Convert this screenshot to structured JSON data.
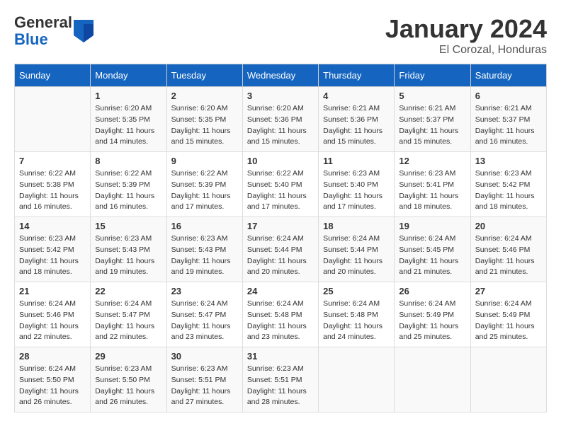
{
  "logo": {
    "general": "General",
    "blue": "Blue"
  },
  "title": "January 2024",
  "location": "El Corozal, Honduras",
  "days_of_week": [
    "Sunday",
    "Monday",
    "Tuesday",
    "Wednesday",
    "Thursday",
    "Friday",
    "Saturday"
  ],
  "weeks": [
    [
      {
        "day": "",
        "sunrise": "",
        "sunset": "",
        "daylight": ""
      },
      {
        "day": "1",
        "sunrise": "Sunrise: 6:20 AM",
        "sunset": "Sunset: 5:35 PM",
        "daylight": "Daylight: 11 hours and 14 minutes."
      },
      {
        "day": "2",
        "sunrise": "Sunrise: 6:20 AM",
        "sunset": "Sunset: 5:35 PM",
        "daylight": "Daylight: 11 hours and 15 minutes."
      },
      {
        "day": "3",
        "sunrise": "Sunrise: 6:20 AM",
        "sunset": "Sunset: 5:36 PM",
        "daylight": "Daylight: 11 hours and 15 minutes."
      },
      {
        "day": "4",
        "sunrise": "Sunrise: 6:21 AM",
        "sunset": "Sunset: 5:36 PM",
        "daylight": "Daylight: 11 hours and 15 minutes."
      },
      {
        "day": "5",
        "sunrise": "Sunrise: 6:21 AM",
        "sunset": "Sunset: 5:37 PM",
        "daylight": "Daylight: 11 hours and 15 minutes."
      },
      {
        "day": "6",
        "sunrise": "Sunrise: 6:21 AM",
        "sunset": "Sunset: 5:37 PM",
        "daylight": "Daylight: 11 hours and 16 minutes."
      }
    ],
    [
      {
        "day": "7",
        "sunrise": "Sunrise: 6:22 AM",
        "sunset": "Sunset: 5:38 PM",
        "daylight": "Daylight: 11 hours and 16 minutes."
      },
      {
        "day": "8",
        "sunrise": "Sunrise: 6:22 AM",
        "sunset": "Sunset: 5:39 PM",
        "daylight": "Daylight: 11 hours and 16 minutes."
      },
      {
        "day": "9",
        "sunrise": "Sunrise: 6:22 AM",
        "sunset": "Sunset: 5:39 PM",
        "daylight": "Daylight: 11 hours and 17 minutes."
      },
      {
        "day": "10",
        "sunrise": "Sunrise: 6:22 AM",
        "sunset": "Sunset: 5:40 PM",
        "daylight": "Daylight: 11 hours and 17 minutes."
      },
      {
        "day": "11",
        "sunrise": "Sunrise: 6:23 AM",
        "sunset": "Sunset: 5:40 PM",
        "daylight": "Daylight: 11 hours and 17 minutes."
      },
      {
        "day": "12",
        "sunrise": "Sunrise: 6:23 AM",
        "sunset": "Sunset: 5:41 PM",
        "daylight": "Daylight: 11 hours and 18 minutes."
      },
      {
        "day": "13",
        "sunrise": "Sunrise: 6:23 AM",
        "sunset": "Sunset: 5:42 PM",
        "daylight": "Daylight: 11 hours and 18 minutes."
      }
    ],
    [
      {
        "day": "14",
        "sunrise": "Sunrise: 6:23 AM",
        "sunset": "Sunset: 5:42 PM",
        "daylight": "Daylight: 11 hours and 18 minutes."
      },
      {
        "day": "15",
        "sunrise": "Sunrise: 6:23 AM",
        "sunset": "Sunset: 5:43 PM",
        "daylight": "Daylight: 11 hours and 19 minutes."
      },
      {
        "day": "16",
        "sunrise": "Sunrise: 6:23 AM",
        "sunset": "Sunset: 5:43 PM",
        "daylight": "Daylight: 11 hours and 19 minutes."
      },
      {
        "day": "17",
        "sunrise": "Sunrise: 6:24 AM",
        "sunset": "Sunset: 5:44 PM",
        "daylight": "Daylight: 11 hours and 20 minutes."
      },
      {
        "day": "18",
        "sunrise": "Sunrise: 6:24 AM",
        "sunset": "Sunset: 5:44 PM",
        "daylight": "Daylight: 11 hours and 20 minutes."
      },
      {
        "day": "19",
        "sunrise": "Sunrise: 6:24 AM",
        "sunset": "Sunset: 5:45 PM",
        "daylight": "Daylight: 11 hours and 21 minutes."
      },
      {
        "day": "20",
        "sunrise": "Sunrise: 6:24 AM",
        "sunset": "Sunset: 5:46 PM",
        "daylight": "Daylight: 11 hours and 21 minutes."
      }
    ],
    [
      {
        "day": "21",
        "sunrise": "Sunrise: 6:24 AM",
        "sunset": "Sunset: 5:46 PM",
        "daylight": "Daylight: 11 hours and 22 minutes."
      },
      {
        "day": "22",
        "sunrise": "Sunrise: 6:24 AM",
        "sunset": "Sunset: 5:47 PM",
        "daylight": "Daylight: 11 hours and 22 minutes."
      },
      {
        "day": "23",
        "sunrise": "Sunrise: 6:24 AM",
        "sunset": "Sunset: 5:47 PM",
        "daylight": "Daylight: 11 hours and 23 minutes."
      },
      {
        "day": "24",
        "sunrise": "Sunrise: 6:24 AM",
        "sunset": "Sunset: 5:48 PM",
        "daylight": "Daylight: 11 hours and 23 minutes."
      },
      {
        "day": "25",
        "sunrise": "Sunrise: 6:24 AM",
        "sunset": "Sunset: 5:48 PM",
        "daylight": "Daylight: 11 hours and 24 minutes."
      },
      {
        "day": "26",
        "sunrise": "Sunrise: 6:24 AM",
        "sunset": "Sunset: 5:49 PM",
        "daylight": "Daylight: 11 hours and 25 minutes."
      },
      {
        "day": "27",
        "sunrise": "Sunrise: 6:24 AM",
        "sunset": "Sunset: 5:49 PM",
        "daylight": "Daylight: 11 hours and 25 minutes."
      }
    ],
    [
      {
        "day": "28",
        "sunrise": "Sunrise: 6:24 AM",
        "sunset": "Sunset: 5:50 PM",
        "daylight": "Daylight: 11 hours and 26 minutes."
      },
      {
        "day": "29",
        "sunrise": "Sunrise: 6:23 AM",
        "sunset": "Sunset: 5:50 PM",
        "daylight": "Daylight: 11 hours and 26 minutes."
      },
      {
        "day": "30",
        "sunrise": "Sunrise: 6:23 AM",
        "sunset": "Sunset: 5:51 PM",
        "daylight": "Daylight: 11 hours and 27 minutes."
      },
      {
        "day": "31",
        "sunrise": "Sunrise: 6:23 AM",
        "sunset": "Sunset: 5:51 PM",
        "daylight": "Daylight: 11 hours and 28 minutes."
      },
      {
        "day": "",
        "sunrise": "",
        "sunset": "",
        "daylight": ""
      },
      {
        "day": "",
        "sunrise": "",
        "sunset": "",
        "daylight": ""
      },
      {
        "day": "",
        "sunrise": "",
        "sunset": "",
        "daylight": ""
      }
    ]
  ]
}
